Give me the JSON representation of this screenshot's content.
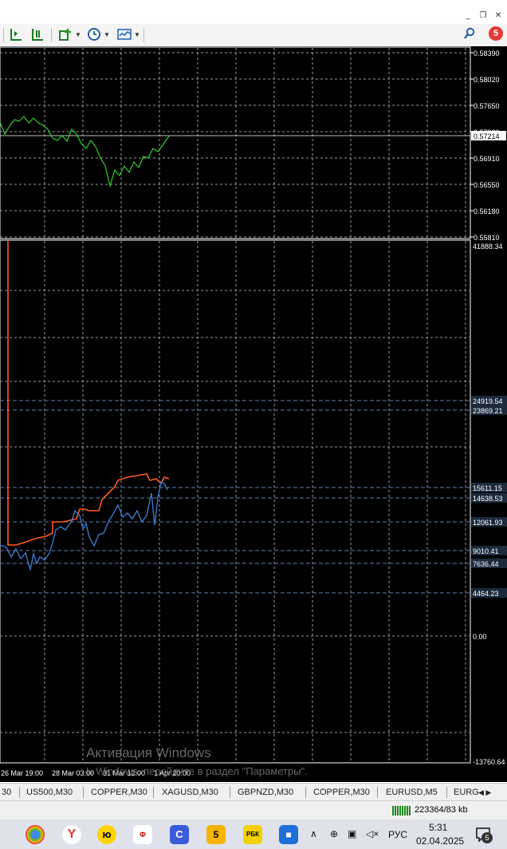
{
  "window": {
    "controls": [
      "_",
      "❐",
      "✕"
    ]
  },
  "toolbar": {
    "notification_count": "5"
  },
  "price_panel": {
    "price_labels": [
      "0.58390",
      "0.58020",
      "0.57650",
      "0.57280",
      "0.56910",
      "0.56550",
      "0.56180",
      "0.55810"
    ],
    "current_price": "0.57214",
    "line_color": "#2ecc2e"
  },
  "equity_panel": {
    "levels": [
      "41888.34",
      "24919.54",
      "23869.21",
      "15611.15",
      "14638.53",
      "12061.93",
      "9010.41",
      "7636.44",
      "4464.23",
      "0.00",
      "-13760.64"
    ],
    "balance_color": "#ff5a1f",
    "equity_color": "#3a78c9"
  },
  "time_axis": [
    "26 Mar 19:00",
    "28 Mar 03:00",
    "31 Mar 12:00",
    "1 Apr 20:00"
  ],
  "watermark": {
    "title": "Активация Windows",
    "subtitle_visible": "Ь Windows, перейдите в раздел \"Параметры\"."
  },
  "symbol_tabs": [
    "30",
    "US500,M30",
    "COPPER,M30",
    "XAGUSD,M30",
    "GBPNZD,M30",
    "COPPER,M30",
    "EURUSD,M5",
    "EURG"
  ],
  "status": {
    "connection": "223364/83 kb"
  },
  "taskbar": {
    "language": "РУС",
    "time": "5:31",
    "date": "02.04.2025",
    "notifications": "5"
  }
}
